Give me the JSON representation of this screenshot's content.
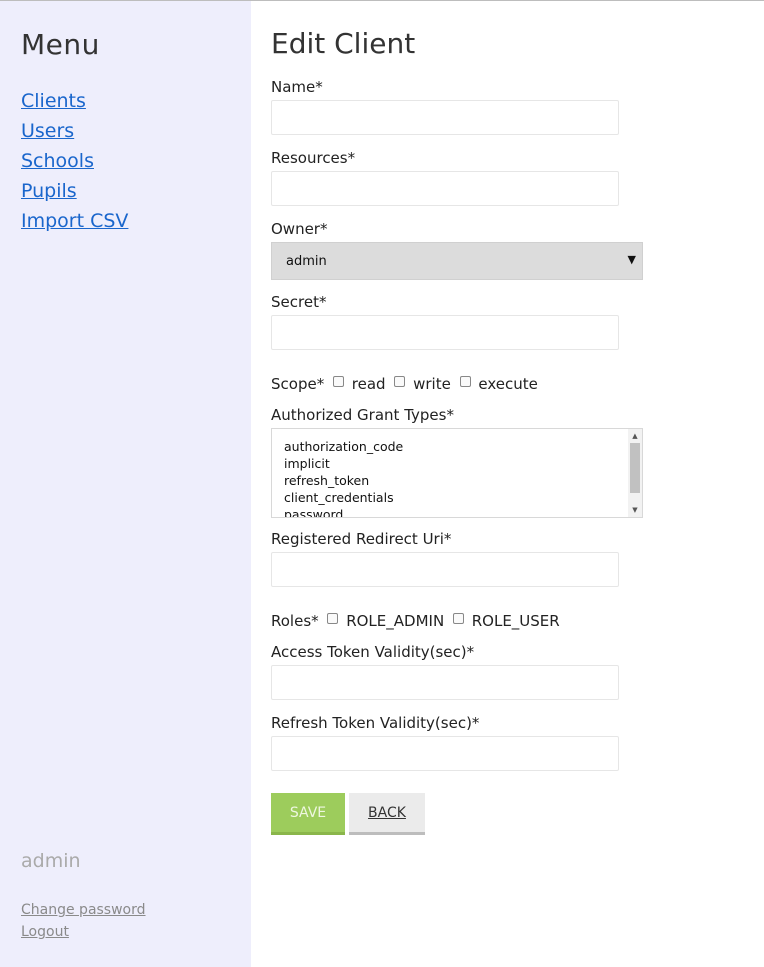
{
  "sidebar": {
    "title": "Menu",
    "nav": [
      "Clients",
      "Users",
      "Schools",
      "Pupils",
      "Import CSV"
    ],
    "username": "admin",
    "change_password": "Change password",
    "logout": "Logout"
  },
  "form": {
    "title": "Edit Client",
    "name_label": "Name*",
    "resources_label": "Resources*",
    "owner_label": "Owner*",
    "owner_value": "admin",
    "secret_label": "Secret*",
    "scope_label": "Scope*",
    "scope_options": [
      "read",
      "write",
      "execute"
    ],
    "grant_types_label": "Authorized Grant Types*",
    "grant_types_options": [
      "authorization_code",
      "implicit",
      "refresh_token",
      "client_credentials",
      "password"
    ],
    "redirect_label": "Registered Redirect Uri*",
    "roles_label": "Roles*",
    "roles_options": [
      "ROLE_ADMIN",
      "ROLE_USER"
    ],
    "access_token_label": "Access Token Validity(sec)*",
    "refresh_token_label": "Refresh Token Validity(sec)*",
    "save_label": "SAVE",
    "back_label": "BACK"
  },
  "colors": {
    "sidebar_bg": "#eeeefc",
    "link": "#1a66cc",
    "save_button": "#9dcc5c",
    "back_button": "#ebebeb"
  }
}
